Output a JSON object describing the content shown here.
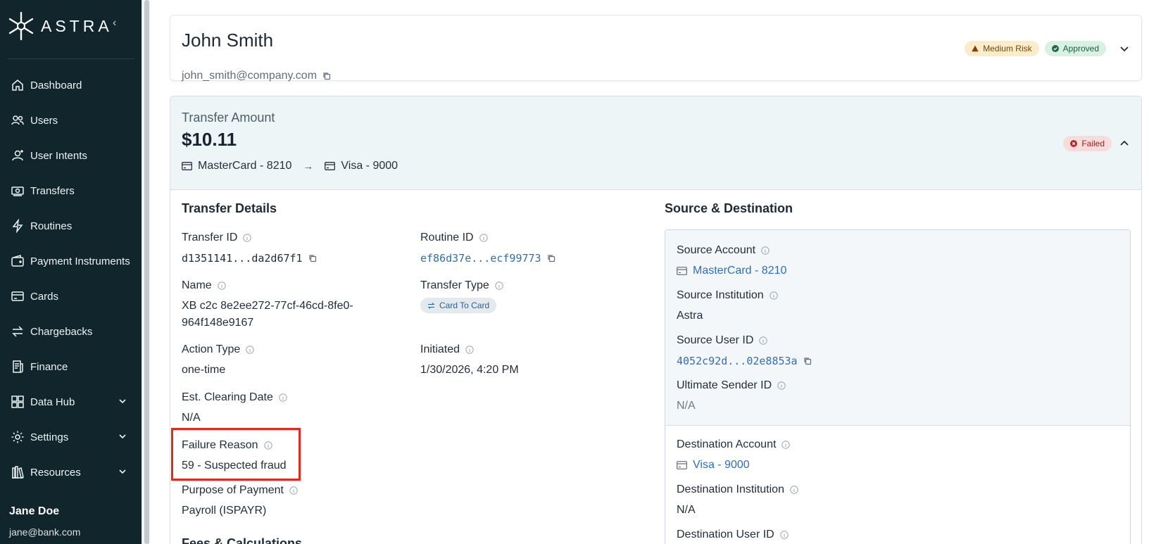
{
  "brand": {
    "name": "ASTRA"
  },
  "nav": [
    {
      "label": "Dashboard",
      "icon": "home-icon"
    },
    {
      "label": "Users",
      "icon": "users-icon"
    },
    {
      "label": "User Intents",
      "icon": "user-icon"
    },
    {
      "label": "Transfers",
      "icon": "money-icon"
    },
    {
      "label": "Routines",
      "icon": "bolt-icon"
    },
    {
      "label": "Payment Instruments",
      "icon": "wallet-icon"
    },
    {
      "label": "Cards",
      "icon": "card-icon"
    },
    {
      "label": "Chargebacks",
      "icon": "swap-icon"
    },
    {
      "label": "Finance",
      "icon": "receipt-icon"
    },
    {
      "label": "Data Hub",
      "icon": "grid-icon"
    },
    {
      "label": "Settings",
      "icon": "gear-icon"
    },
    {
      "label": "Resources",
      "icon": "library-icon"
    }
  ],
  "current_user": {
    "name": "Jane Doe",
    "email": "jane@bank.com"
  },
  "customer": {
    "name": "John Smith",
    "email": "john_smith@company.com",
    "risk_badge": "Medium Risk",
    "status_badge": "Approved"
  },
  "transfer": {
    "amount_label": "Transfer Amount",
    "amount": "$10.11",
    "from": "MasterCard - 8210",
    "to": "Visa - 9000",
    "status": "Failed"
  },
  "details": {
    "title": "Transfer Details",
    "transfer_id_label": "Transfer ID",
    "transfer_id": "d1351141...da2d67f1",
    "routine_id_label": "Routine ID",
    "routine_id": "ef86d37e...ecf99773",
    "name_label": "Name",
    "name_line1": "XB c2c 8e2ee272-77cf-46cd-8fe0-",
    "name_line2": "964f148e9167",
    "transfer_type_label": "Transfer Type",
    "transfer_type": "Card To Card",
    "action_type_label": "Action Type",
    "action_type": "one-time",
    "initiated_label": "Initiated",
    "initiated": "1/30/2026, 4:20 PM",
    "clearing_label": "Est. Clearing Date",
    "clearing": "N/A",
    "failure_label": "Failure Reason",
    "failure": "59 - Suspected fraud",
    "purpose_label": "Purpose of Payment",
    "purpose": "Payroll (ISPAYR)",
    "fees_title": "Fees & Calculations"
  },
  "source_dest": {
    "title": "Source & Destination",
    "source_account_label": "Source Account",
    "source_account": "MasterCard - 8210",
    "source_institution_label": "Source Institution",
    "source_institution": "Astra",
    "source_user_label": "Source User ID",
    "source_user": "4052c92d...02e8853a",
    "ultimate_sender_label": "Ultimate Sender ID",
    "ultimate_sender": "N/A",
    "dest_account_label": "Destination Account",
    "dest_account": "Visa - 9000",
    "dest_institution_label": "Destination Institution",
    "dest_institution": "N/A",
    "dest_user_label": "Destination User ID"
  }
}
